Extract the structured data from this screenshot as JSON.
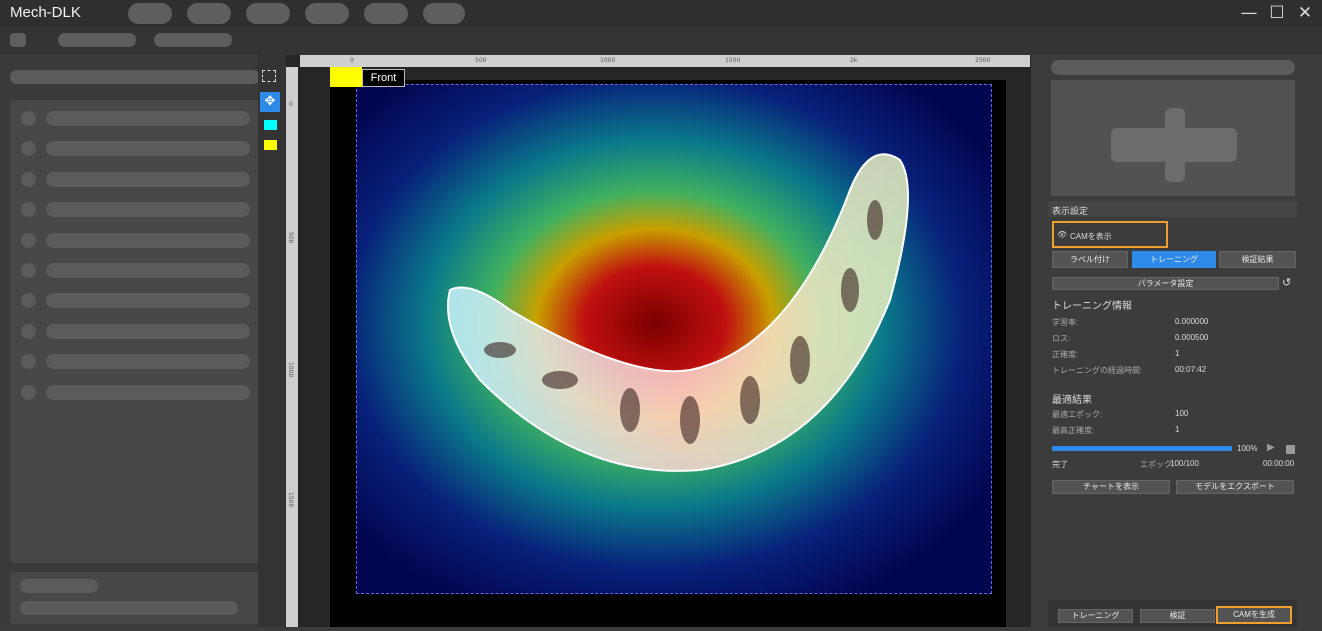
{
  "app": {
    "title": "Mech-DLK"
  },
  "window_controls": {
    "minimize": "—",
    "maximize": "☐",
    "close": "✕"
  },
  "canvas": {
    "label_name": "Front",
    "ruler_top_ticks": [
      "0",
      "500",
      "1000",
      "1500",
      "2k",
      "2500"
    ],
    "ruler_left_ticks": [
      "0",
      "500",
      "1000",
      "1500"
    ]
  },
  "right_panel": {
    "display_settings_title": "表示設定",
    "show_cam_label": "CAMを表示",
    "tabs": [
      {
        "label": "ラベル付け",
        "active": false
      },
      {
        "label": "トレーニング",
        "active": true
      },
      {
        "label": "検証結果",
        "active": false
      }
    ],
    "param_button": "パラメータ設定",
    "training_info_title": "トレーニング情報",
    "training_info": [
      {
        "label": "学習率:",
        "value": "0.000000"
      },
      {
        "label": "ロス:",
        "value": "0.000500"
      },
      {
        "label": "正確度:",
        "value": "1"
      },
      {
        "label": "トレーニングの経過時間:",
        "value": "00:07:42"
      }
    ],
    "best_result_title": "最適結果",
    "best_results": [
      {
        "label": "最適エポック:",
        "value": "100"
      },
      {
        "label": "最高正確度:",
        "value": "1"
      }
    ],
    "progress": {
      "percent_text": "100%",
      "fraction": 1.0,
      "status": "完了",
      "epoch_label": "エポック:",
      "epoch_value": "100/100",
      "time": "00:00:00"
    },
    "show_chart_button": "チャートを表示",
    "export_model_button": "モデルをエクスポート",
    "bottom_buttons": {
      "train": "トレーニング",
      "validate": "検証",
      "generate_cam": "CAMを生成"
    },
    "accent_color": "#2d8ae8",
    "highlight_color": "#f0a030"
  }
}
